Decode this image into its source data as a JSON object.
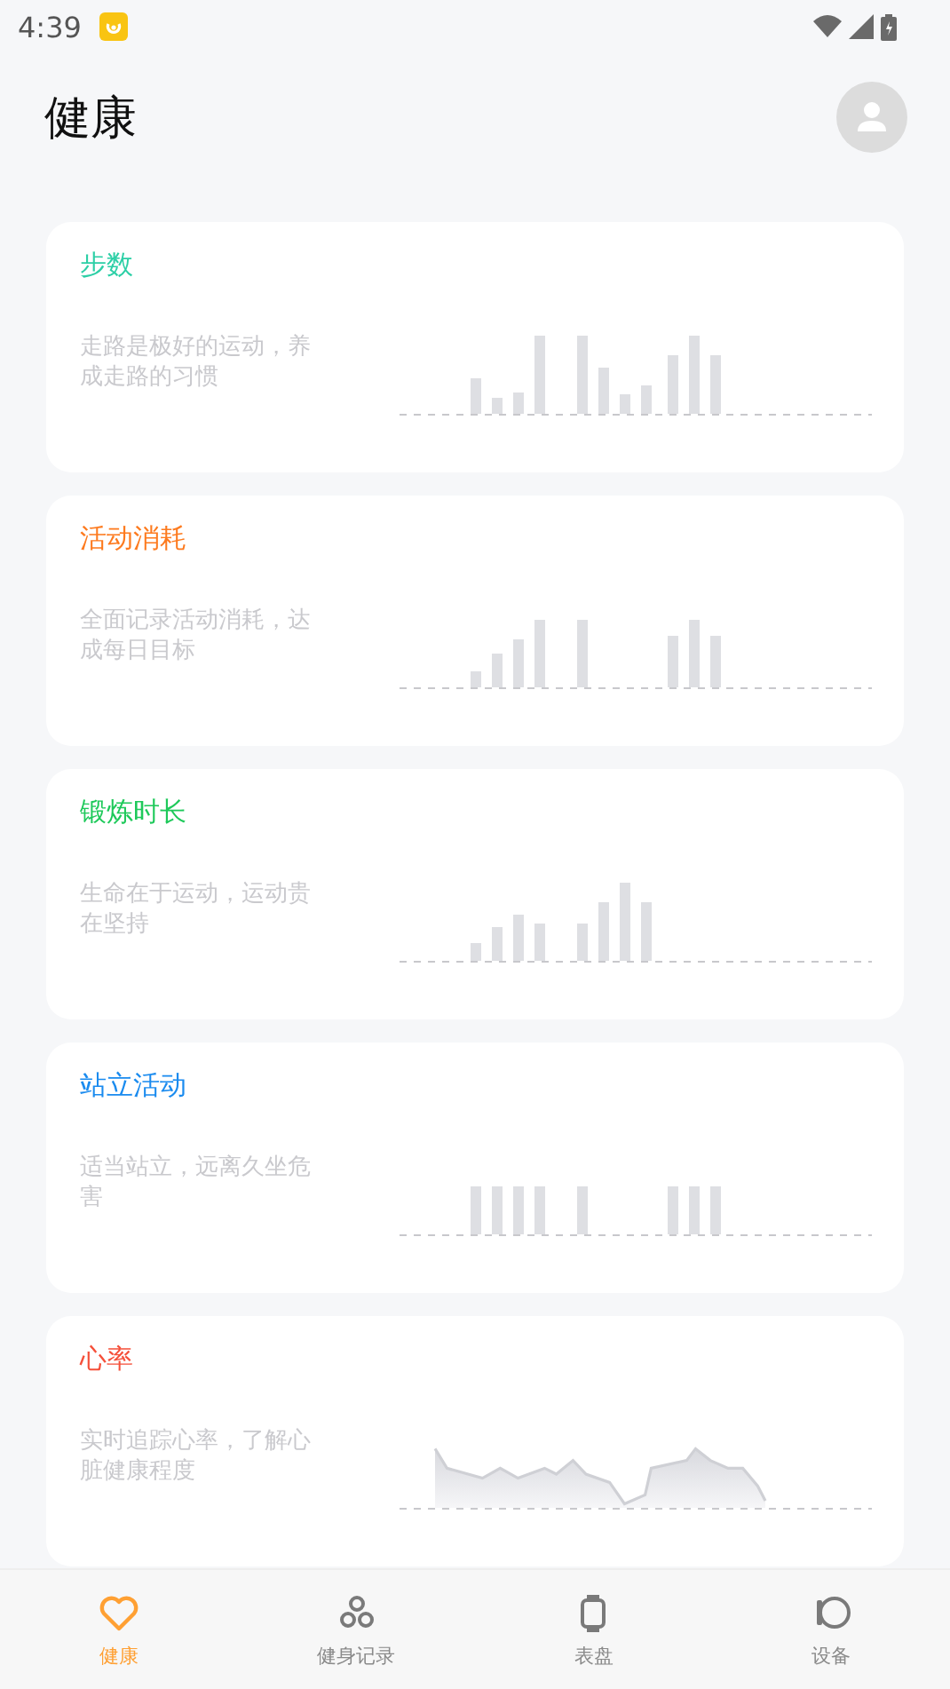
{
  "status_bar": {
    "time": "4:39"
  },
  "header": {
    "title": "健康"
  },
  "cards": [
    {
      "title": "步数",
      "color": "#2ccfa6",
      "description": "走路是极好的运动，养成走路的习惯",
      "kind": "bars"
    },
    {
      "title": "活动消耗",
      "color": "#fd7a1e",
      "description": "全面记录活动消耗，达成每日目标",
      "kind": "bars"
    },
    {
      "title": "锻炼时长",
      "color": "#1ec95a",
      "description": "生命在于运动，运动贵在坚持",
      "kind": "bars"
    },
    {
      "title": "站立活动",
      "color": "#1a8bef",
      "description": "适当站立，远离久坐危害",
      "kind": "bars"
    },
    {
      "title": "心率",
      "color": "#f5503a",
      "description": "实时追踪心率，了解心脏健康程度",
      "kind": "line"
    }
  ],
  "tabs": [
    {
      "label": "健康",
      "selected": true
    },
    {
      "label": "健身记录",
      "selected": false
    },
    {
      "label": "表盘",
      "selected": false
    },
    {
      "label": "设备",
      "selected": false
    }
  ]
}
